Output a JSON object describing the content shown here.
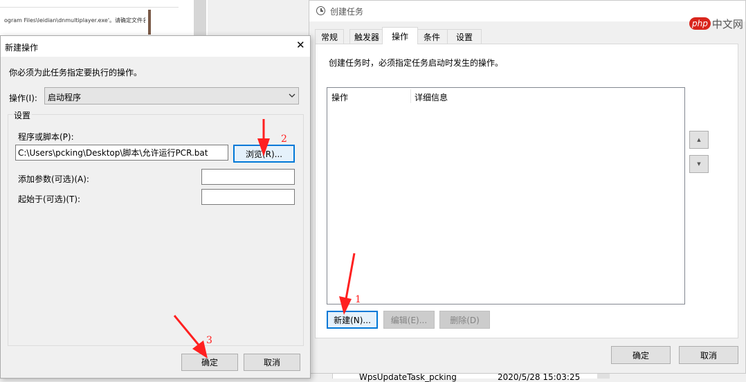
{
  "bg_window": {
    "path_fragment": "ogram Files\\leidian\\dnmultiplayer.exe'。请确定文件名是否正",
    "task_name": "WpsUpdateTask_pcking",
    "task_time": "2020/5/28 15:03:25"
  },
  "create_task": {
    "title": "创建任务",
    "tabs": [
      {
        "label": "常规"
      },
      {
        "label": "触发器"
      },
      {
        "label": "操作"
      },
      {
        "label": "条件"
      },
      {
        "label": "设置"
      }
    ],
    "description": "创建任务时，必须指定任务启动时发生的操作。",
    "columns": [
      "操作",
      "详细信息"
    ],
    "up_icon": "▲",
    "down_icon": "▼",
    "new_label": "新建(N)...",
    "edit_label": "编辑(E)...",
    "delete_label": "删除(D)",
    "ok_label": "确定",
    "cancel_label": "取消"
  },
  "new_action": {
    "title": "新建操作",
    "close_icon": "✕",
    "instruction": "你必须为此任务指定要执行的操作。",
    "action_label": "操作(I):",
    "action_value": "启动程序",
    "settings_label": "设置",
    "program_label": "程序或脚本(P):",
    "program_value": "C:\\Users\\pcking\\Desktop\\脚本\\允许运行PCR.bat",
    "browse_label": "浏览(R)...",
    "args_label": "添加参数(可选)(A):",
    "start_in_label": "起始于(可选)(T):",
    "ok_label": "确定",
    "cancel_label": "取消"
  },
  "annotations": {
    "step1": "1",
    "step2": "2",
    "step3": "3",
    "arrow_color": "#ff2020"
  },
  "watermark": {
    "brand": "php",
    "site": "中文网"
  }
}
